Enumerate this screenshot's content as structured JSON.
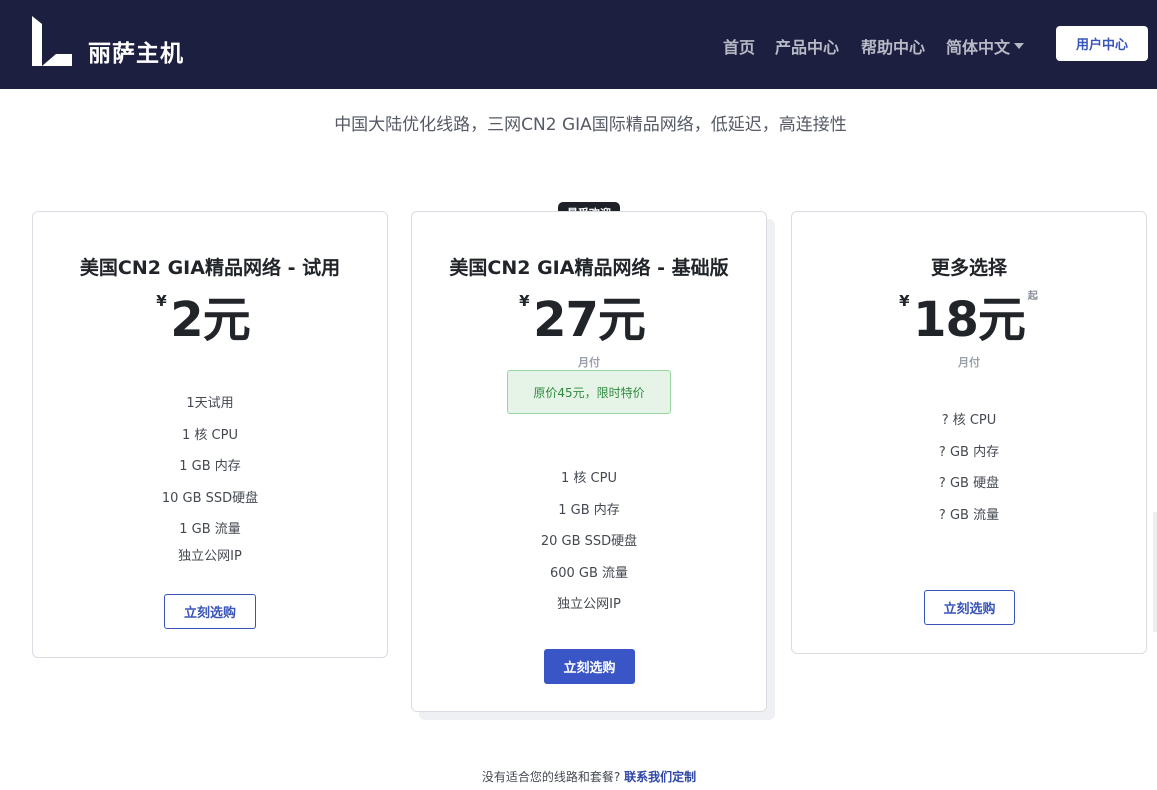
{
  "header": {
    "brand": "丽萨主机",
    "nav": [
      "首页",
      "产品中心",
      "帮助中心"
    ],
    "language": "简体中文",
    "user_button": "用户中心"
  },
  "subtitle": "中国大陆优化线路，三网CN2 GIA国际精品网络，低延迟，高连接性",
  "badge": "最受欢迎",
  "currency_symbol": "¥",
  "plans": [
    {
      "title": "美国CN2 GIA精品网络 - 试用",
      "price": "2元",
      "features": [
        "1天试用",
        "1 核 CPU",
        "1 GB 内存",
        "10 GB SSD硬盘",
        "1 GB 流量",
        "独立公网IP"
      ],
      "button": "立刻选购"
    },
    {
      "title": "美国CN2 GIA精品网络 - 基础版",
      "price": "27元",
      "period": "月付",
      "promo": "原价45元，限时特价",
      "features": [
        "1 核 CPU",
        "1 GB 内存",
        "20 GB SSD硬盘",
        "600 GB 流量",
        "独立公网IP"
      ],
      "button": "立刻选购"
    },
    {
      "title": "更多选择",
      "price": "18元",
      "price_suffix": "起",
      "period": "月付",
      "features": [
        "? 核 CPU",
        "? GB 内存",
        "? GB 硬盘",
        "? GB 流量"
      ],
      "button": "立刻选购"
    }
  ],
  "footer": {
    "question": "没有适合您的线路和套餐?",
    "link": "联系我们定制"
  },
  "colors": {
    "navbar": "#1c1f3f",
    "accent": "#3a55c6",
    "promo_bg": "#e6f4e8",
    "promo_text": "#2f8a3f"
  }
}
